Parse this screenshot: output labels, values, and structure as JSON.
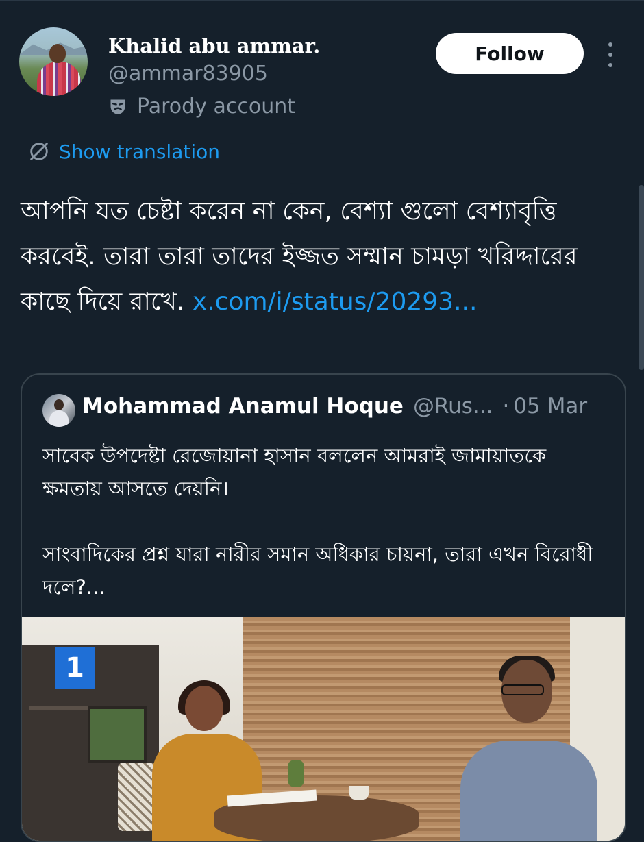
{
  "author": {
    "display_name": "Khalid abu ammar.",
    "handle": "@ammar83905",
    "label": "Parody account",
    "label_icon": "parody-mask-icon"
  },
  "actions": {
    "follow_label": "Follow",
    "more_icon": "more-vertical-icon"
  },
  "translation": {
    "label": "Show translation",
    "icon": "translate-icon",
    "color": "#1d9bf0"
  },
  "tweet": {
    "text": "আপনি যত চেষ্টা করেন না কেন, বেশ্যা গুলো বেশ্যাবৃত্তি করবেই. তারা  তারা তাদের ইজ্জত সম্মান চামড়া খরিদ্দারের কাছে দিয়ে রাখে. ",
    "link": "x.com/i/status/20293..."
  },
  "quote": {
    "name": "Mohammad Anamul Hoque",
    "handle": "@Rus...",
    "separator": "·",
    "date": "05 Mar",
    "paragraph1": "সাবেক উপদেষ্টা রেজোয়ানা হাসান বললেন আমরাই জামায়াতকে ক্ষমতায় আসতে দেয়নি।",
    "paragraph2": "সাংবাদিকের প্রশ্ন যারা নারীর সমান অধিকার চায়না, তারা এখন বিরোধী দলে?...",
    "media_logo": "1"
  },
  "colors": {
    "background": "#15202b",
    "secondary_text": "#8b98a5",
    "link": "#1d9bf0",
    "border": "#38444d"
  }
}
